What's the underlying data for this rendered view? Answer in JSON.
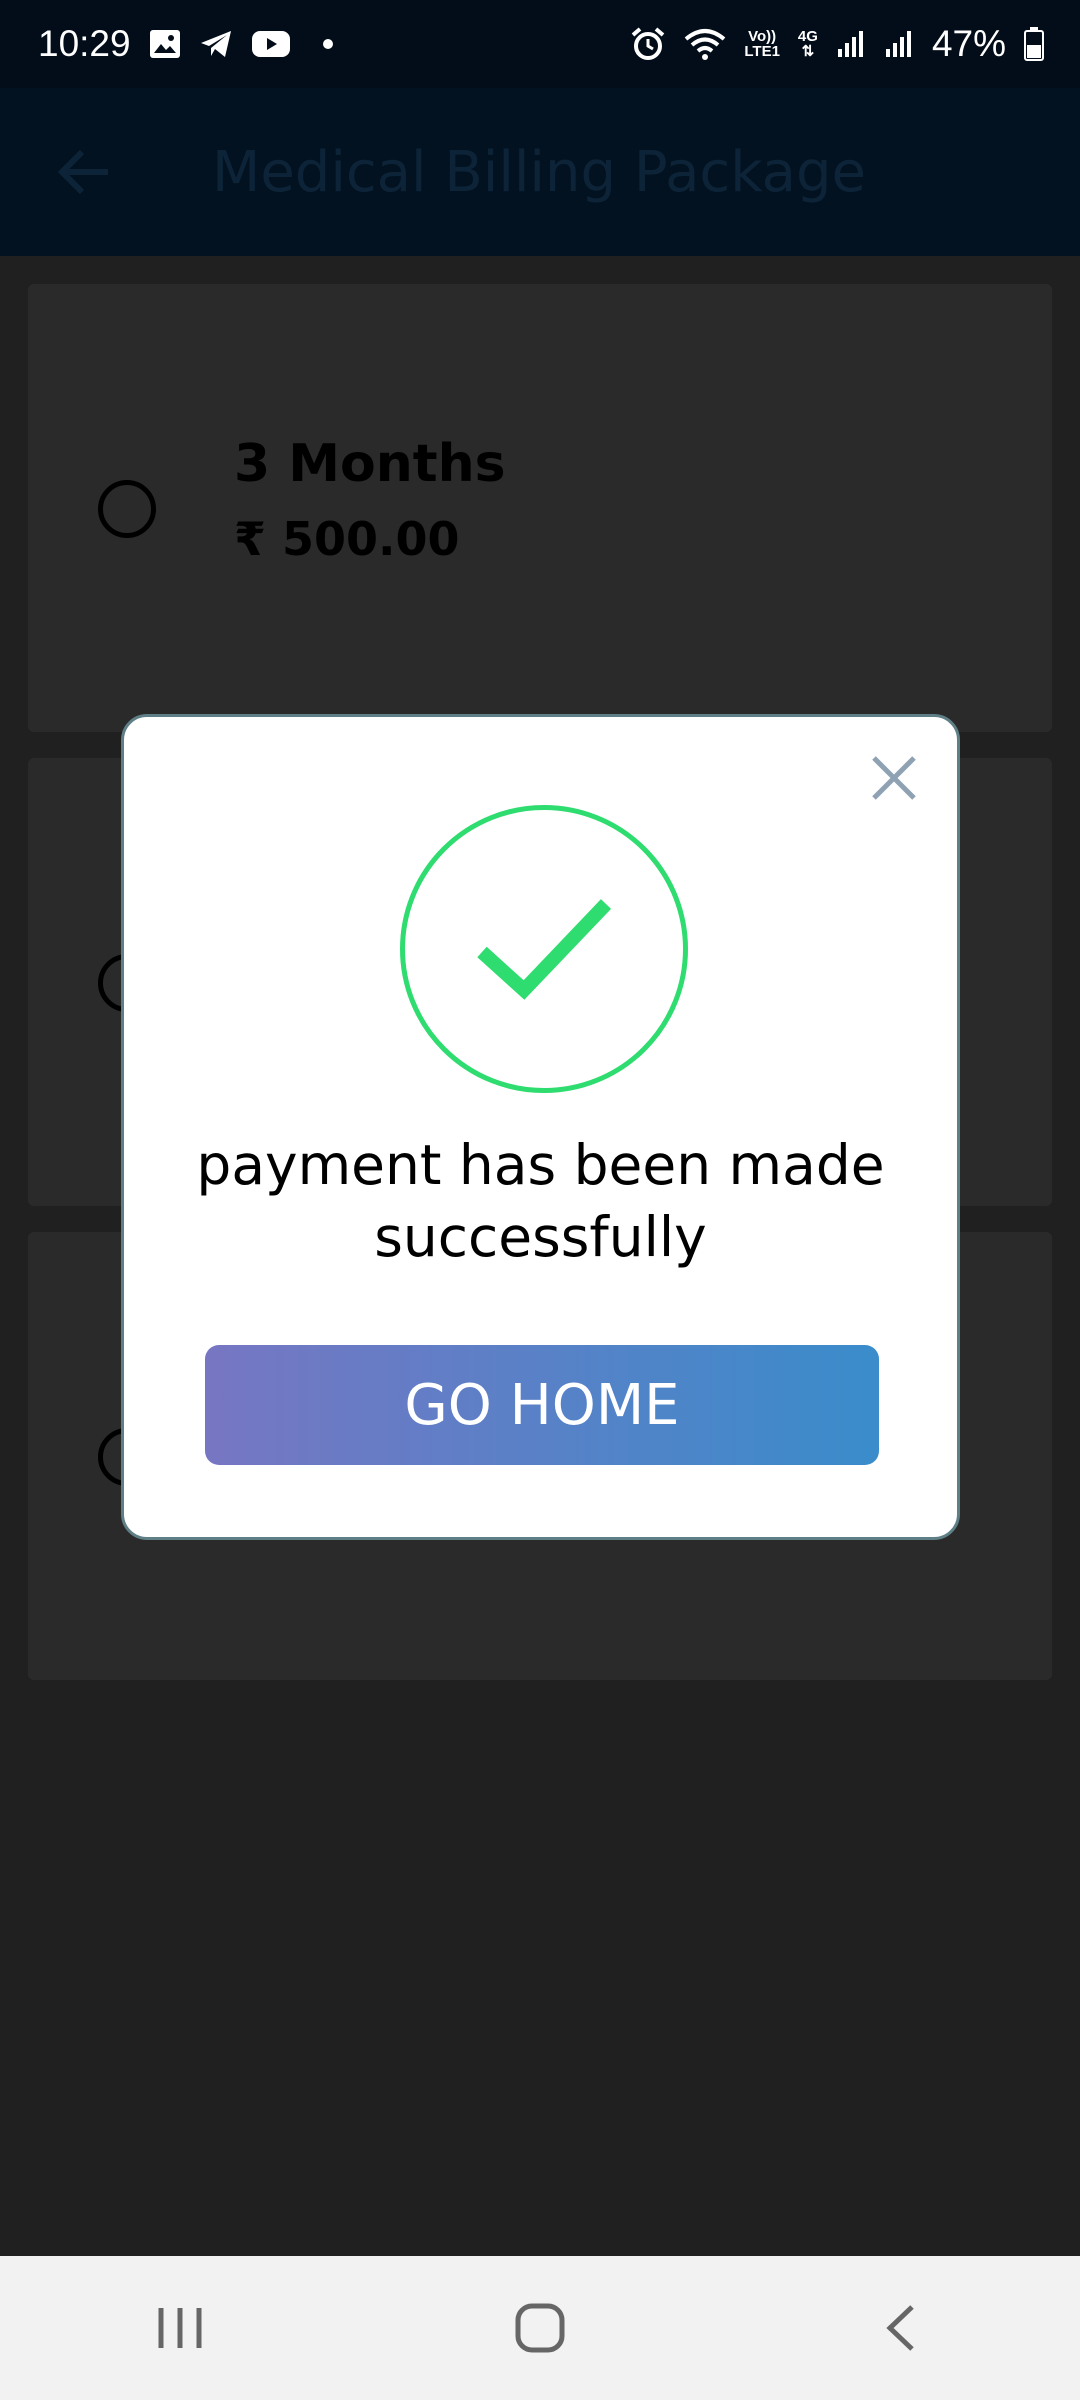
{
  "status_bar": {
    "time": "10:29",
    "network_voice": "Vo))",
    "network_lte": "LTE1",
    "network_gen": "4G",
    "battery": "47%",
    "icons": [
      "gallery-icon",
      "telegram-icon",
      "youtube-icon",
      "alarm-icon",
      "wifi-icon",
      "signal-icon",
      "battery-icon"
    ]
  },
  "app_bar": {
    "title": "Medical Billing Package",
    "back_icon": "arrow-left-icon"
  },
  "packages": [
    {
      "duration": "3 Months",
      "price": "₹ 500.00"
    }
  ],
  "modal": {
    "message": "payment has been made successfully",
    "button_label": "GO HOME",
    "icon": "check-circle-icon",
    "accent_color": "#2fdc6f",
    "button_gradient": [
      "#7776c3",
      "#3a8ccb"
    ]
  },
  "nav_bar": {
    "icons": [
      "recent-apps-icon",
      "home-icon",
      "back-icon"
    ]
  }
}
